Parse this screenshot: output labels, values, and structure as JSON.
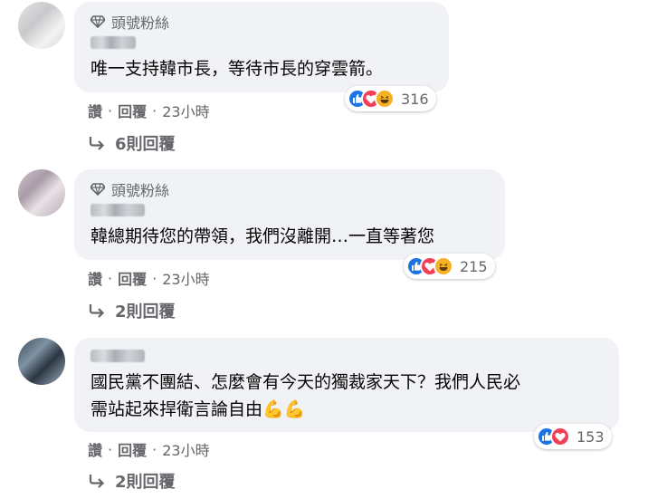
{
  "comments": [
    {
      "badge": "頭號粉絲",
      "text_lines": [
        "唯一支持韓市長，等待市長的穿雲箭。"
      ],
      "reaction_count": "316",
      "reactions": [
        "like-icon",
        "love-icon",
        "haha-icon"
      ],
      "actions": {
        "like": "讚",
        "reply": "回覆",
        "time": "23小時"
      },
      "replies_label": "6則回覆"
    },
    {
      "badge": "頭號粉絲",
      "text_lines": [
        "韓總期待您的帶領，我們沒離開…一直等著您"
      ],
      "reaction_count": "215",
      "reactions": [
        "like-icon",
        "love-icon",
        "haha-icon"
      ],
      "actions": {
        "like": "讚",
        "reply": "回覆",
        "time": "23小時"
      },
      "replies_label": "2則回覆"
    },
    {
      "text_lines": [
        "國民黨不團結、怎麼會有今天的獨裁家天下？我們人民必",
        "需站起來捍衛言論自由💪💪"
      ],
      "reaction_count": "153",
      "reactions": [
        "like-icon",
        "love-icon"
      ],
      "actions": {
        "like": "讚",
        "reply": "回覆",
        "time": "23小時"
      },
      "replies_label": "2則回覆"
    }
  ],
  "colors": {
    "bubble": "#f0f2f5",
    "meta_text": "#65676b",
    "like": "#1b74e4",
    "love": "#f33e58",
    "haha": "#f7b125"
  }
}
